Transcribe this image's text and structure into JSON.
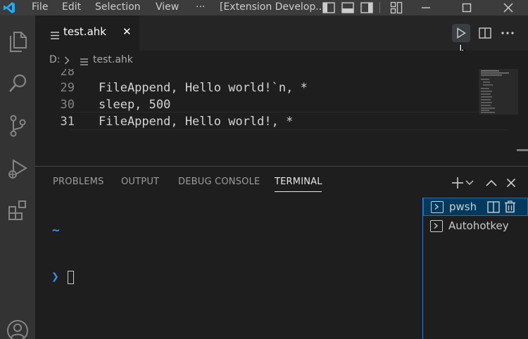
{
  "menubar": {
    "items": [
      "File",
      "Edit",
      "Selection",
      "View",
      "···"
    ],
    "window_title": "[Extension Develop..."
  },
  "tab": {
    "filename": "test.ahk",
    "close_glyph": "✕"
  },
  "breadcrumb": {
    "drive": "D:",
    "file": "test.ahk"
  },
  "editor": {
    "lines": [
      {
        "number": "28",
        "code": ""
      },
      {
        "number": "29",
        "code": "FileAppend, Hello world!`n, *"
      },
      {
        "number": "30",
        "code": "sleep, 500"
      },
      {
        "number": "31",
        "code": "FileAppend, Hello world!, *"
      }
    ],
    "current_line": "31"
  },
  "panel": {
    "tabs": [
      "PROBLEMS",
      "OUTPUT",
      "DEBUG CONSOLE",
      "TERMINAL"
    ],
    "active_tab": "TERMINAL"
  },
  "terminal": {
    "path_prompt": "~",
    "input_prompt": "❯"
  },
  "terminal_list": [
    {
      "name": "pwsh",
      "selected": true
    },
    {
      "name": "Autohotkey",
      "selected": false
    }
  ],
  "colors": {
    "accent": "#0078d4",
    "prompt": "#3b8eea",
    "titlebar": "#3c3c3c",
    "activitybar": "#333333",
    "editor_bg": "#1e1e1e"
  },
  "icons": {
    "app": "vscode-logo-icon",
    "activity": [
      "explorer-icon",
      "search-icon",
      "source-control-icon",
      "run-debug-icon",
      "extensions-icon",
      "account-icon"
    ]
  }
}
